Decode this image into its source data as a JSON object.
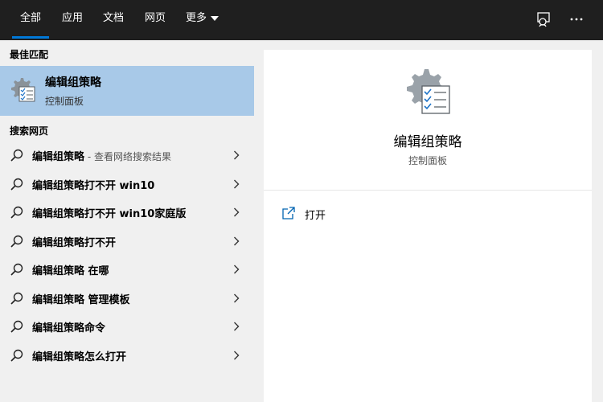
{
  "tabs": [
    {
      "label": "全部",
      "active": true
    },
    {
      "label": "应用",
      "active": false
    },
    {
      "label": "文档",
      "active": false
    },
    {
      "label": "网页",
      "active": false
    },
    {
      "label": "更多",
      "active": false
    }
  ],
  "toolbar_icons": [
    "feedback-icon",
    "more-options-icon"
  ],
  "best_match": {
    "section_label": "最佳匹配",
    "title": "编辑组策略",
    "subtitle": "控制面板",
    "icon": "group-policy-icon"
  },
  "web_search": {
    "section_label": "搜索网页",
    "items": [
      {
        "query": "编辑组策略",
        "hint": " - 查看网络搜索结果"
      },
      {
        "query": "编辑组策略打不开 win10",
        "hint": ""
      },
      {
        "query": "编辑组策略打不开 win10家庭版",
        "hint": ""
      },
      {
        "query": "编辑组策略打不开",
        "hint": ""
      },
      {
        "query": "编辑组策略 在哪",
        "hint": ""
      },
      {
        "query": "编辑组策略 管理模板",
        "hint": ""
      },
      {
        "query": "编辑组策略命令",
        "hint": ""
      },
      {
        "query": "编辑组策略怎么打开",
        "hint": ""
      }
    ]
  },
  "preview": {
    "title": "编辑组策略",
    "subtitle": "控制面板",
    "actions": [
      {
        "label": "打开",
        "icon": "open-external-icon"
      }
    ]
  },
  "colors": {
    "topbar_bg": "#1f1f1f",
    "active_tab_underline": "#0078d7",
    "selected_row_bg": "#a8c9e8",
    "left_pane_bg": "#f0f0f0",
    "right_pane_bg": "#ffffff"
  }
}
